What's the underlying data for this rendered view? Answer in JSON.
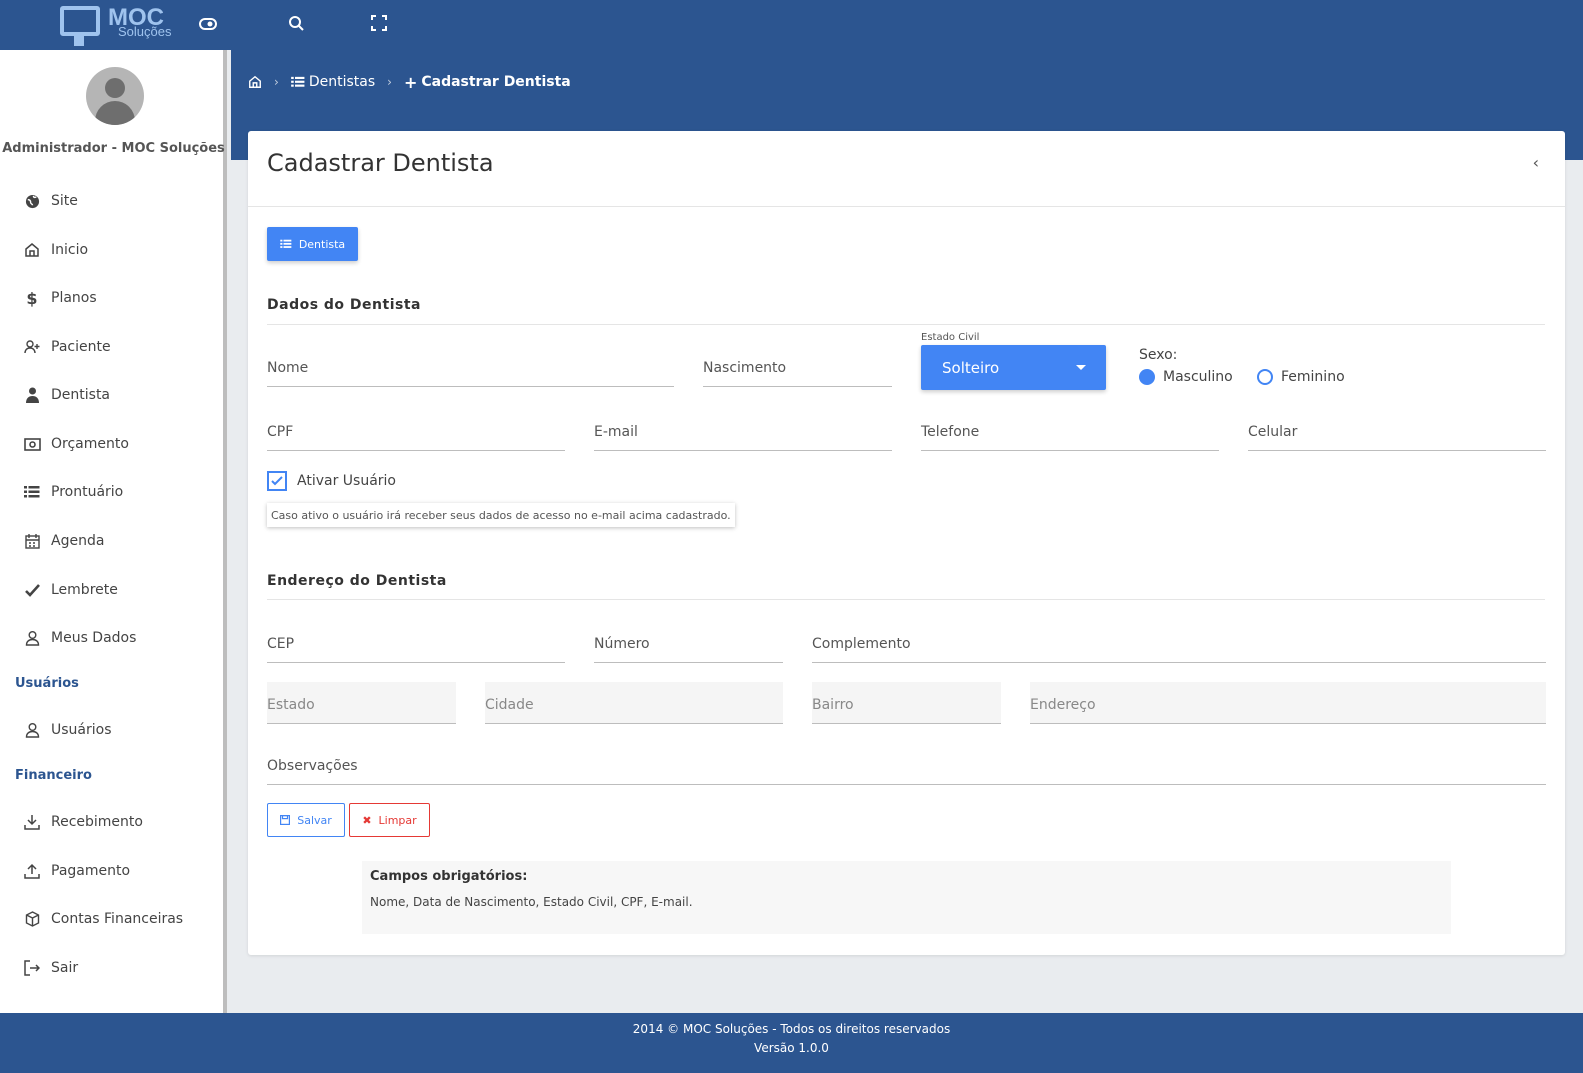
{
  "brand": {
    "line1": "MOC",
    "line2": "Soluções"
  },
  "user": {
    "name": "Administrador - MOC Soluções"
  },
  "sidebar": {
    "items": [
      {
        "label": "Site"
      },
      {
        "label": "Inicio"
      },
      {
        "label": "Planos"
      },
      {
        "label": "Paciente"
      },
      {
        "label": "Dentista"
      },
      {
        "label": "Orçamento"
      },
      {
        "label": "Prontuário"
      },
      {
        "label": "Agenda"
      },
      {
        "label": "Lembrete"
      },
      {
        "label": "Meus Dados"
      }
    ],
    "section_users": "Usuários",
    "users_items": [
      {
        "label": "Usuários"
      }
    ],
    "section_finance": "Financeiro",
    "finance_items": [
      {
        "label": "Recebimento"
      },
      {
        "label": "Pagamento"
      },
      {
        "label": "Contas Financeiras"
      },
      {
        "label": "Sair"
      }
    ]
  },
  "breadcrumb": {
    "list": "Dentistas",
    "current": "Cadastrar Dentista"
  },
  "card": {
    "title": "Cadastrar Dentista",
    "dentista_button": "Dentista"
  },
  "sections": {
    "dados": "Dados do Dentista",
    "endereco": "Endereço do Dentista"
  },
  "form": {
    "nome": "Nome",
    "nascimento": "Nascimento",
    "estado_civil_label": "Estado Civil",
    "estado_civil_value": "Solteiro",
    "sexo_label": "Sexo:",
    "sexo_options": [
      "Masculino",
      "Feminino"
    ],
    "sexo_selected": "Masculino",
    "cpf": "CPF",
    "email": "E-mail",
    "telefone": "Telefone",
    "celular": "Celular",
    "ativar_usuario": "Ativar Usuário",
    "ativar_checked": true,
    "ativar_hint": "Caso ativo o usuário irá receber seus dados de acesso no e-mail acima cadastrado.",
    "cep": "CEP",
    "numero": "Número",
    "complemento": "Complemento",
    "estado": "Estado",
    "cidade": "Cidade",
    "bairro": "Bairro",
    "endereco": "Endereço",
    "observacoes": "Observações"
  },
  "actions": {
    "salvar": "Salvar",
    "limpar": "Limpar"
  },
  "required": {
    "title": "Campos obrigatórios:",
    "text": "Nome, Data de Nascimento, Estado Civil, CPF, E-mail."
  },
  "footer": {
    "line1": "2014 © MOC Soluções - Todos os direitos reservados",
    "line2": "Versão 1.0.0"
  },
  "colors": {
    "brand": "#2c5590",
    "accent": "#4285f4",
    "danger": "#e53935"
  }
}
